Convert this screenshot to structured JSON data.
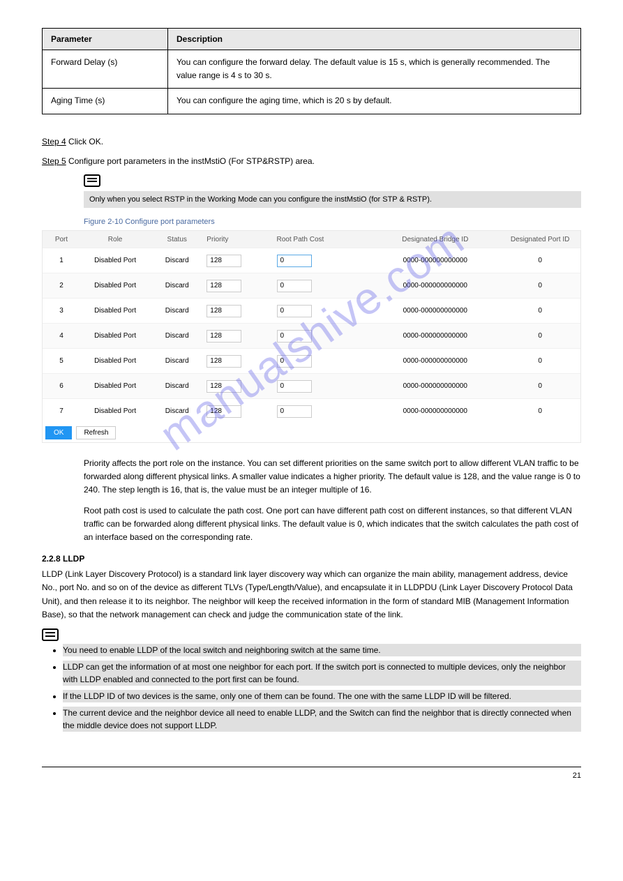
{
  "paramTable": {
    "headers": [
      "Parameter",
      "Description"
    ],
    "rows": [
      {
        "param": "Forward Delay (s)",
        "desc": "You can configure the forward delay. The default value is 15 s, which is generally recommended. The value range is 4 s to 30 s."
      },
      {
        "param": "Aging Time (s)",
        "desc": "You can configure the aging time, which is 20 s by default."
      }
    ]
  },
  "step4": {
    "prefix": "Step 4",
    "text": "Click OK."
  },
  "step5": {
    "prefix": "Step 5",
    "text": "Configure port parameters in the instMstiO (For STP&RSTP) area."
  },
  "noteBlock": {
    "text": "Only when you select RSTP in the Working Mode can you configure the instMstiO (for STP & RSTP)."
  },
  "figureLabel": "Figure 2-10 Configure port parameters",
  "shHeaders": {
    "port": "Port",
    "role": "Role",
    "status": "Status",
    "priority": "Priority",
    "cost": "Root Path Cost",
    "bridge": "Designated Bridge ID",
    "dport": "Designated Port ID"
  },
  "shRows": [
    {
      "port": "1",
      "role": "Disabled Port",
      "status": "Discard",
      "priority": "128",
      "cost": "0",
      "bridge": "0000-000000000000",
      "dport": "0",
      "active": true
    },
    {
      "port": "2",
      "role": "Disabled Port",
      "status": "Discard",
      "priority": "128",
      "cost": "0",
      "bridge": "0000-000000000000",
      "dport": "0"
    },
    {
      "port": "3",
      "role": "Disabled Port",
      "status": "Discard",
      "priority": "128",
      "cost": "0",
      "bridge": "0000-000000000000",
      "dport": "0"
    },
    {
      "port": "4",
      "role": "Disabled Port",
      "status": "Discard",
      "priority": "128",
      "cost": "0",
      "bridge": "0000-000000000000",
      "dport": "0"
    },
    {
      "port": "5",
      "role": "Disabled Port",
      "status": "Discard",
      "priority": "128",
      "cost": "0",
      "bridge": "0000-000000000000",
      "dport": "0"
    },
    {
      "port": "6",
      "role": "Disabled Port",
      "status": "Discard",
      "priority": "128",
      "cost": "0",
      "bridge": "0000-000000000000",
      "dport": "0"
    },
    {
      "port": "7",
      "role": "Disabled Port",
      "status": "Discard",
      "priority": "128",
      "cost": "0",
      "bridge": "0000-000000000000",
      "dport": "0"
    }
  ],
  "btnOk": "OK",
  "btnRefresh": "Refresh",
  "watermark": "manualshive.com",
  "prose": {
    "p1": "Priority affects the port role on the instance. You can set different priorities on the same switch port to allow different VLAN traffic to be forwarded along different physical links. A smaller value indicates a higher priority. The default value is 128, and the value range is 0 to 240. The step length is 16, that is, the value must be an integer multiple of 16.",
    "p2": "Root path cost is used to calculate the path cost. One port can have different path cost on different instances, so that different VLAN traffic can be forwarded along different physical links. The default value is 0, which indicates that the switch calculates the path cost of an interface based on the corresponding rate."
  },
  "section228": {
    "title": "2.2.8 LLDP",
    "intro": "LLDP (Link Layer Discovery Protocol) is a standard link layer discovery way which can organize the main ability, management address, device No., port No. and so on of the device as different TLVs (Type/Length/Value), and encapsulate it in LLDPDU (Link Layer Discovery Protocol Data Unit), and then release it to its neighbor. The neighbor will keep the received information in the form of standard MIB (Management Information Base), so that the network management can check and judge the communication state of the link."
  },
  "notesList": {
    "items": [
      "You need to enable LLDP of the local switch and neighboring switch at the same time.",
      "LLDP can get the information of at most one neighbor for each port. If the switch port is connected to multiple devices, only the neighbor with LLDP enabled and connected to the port first can be found.",
      "If the LLDP ID of two devices is the same, only one of them can be found. The one with the same LLDP ID will be filtered.",
      "The current device and the neighbor device all need to enable LLDP, and the Switch can find the neighbor that is directly connected when the middle device does not support LLDP."
    ]
  },
  "pageNumber": "21"
}
